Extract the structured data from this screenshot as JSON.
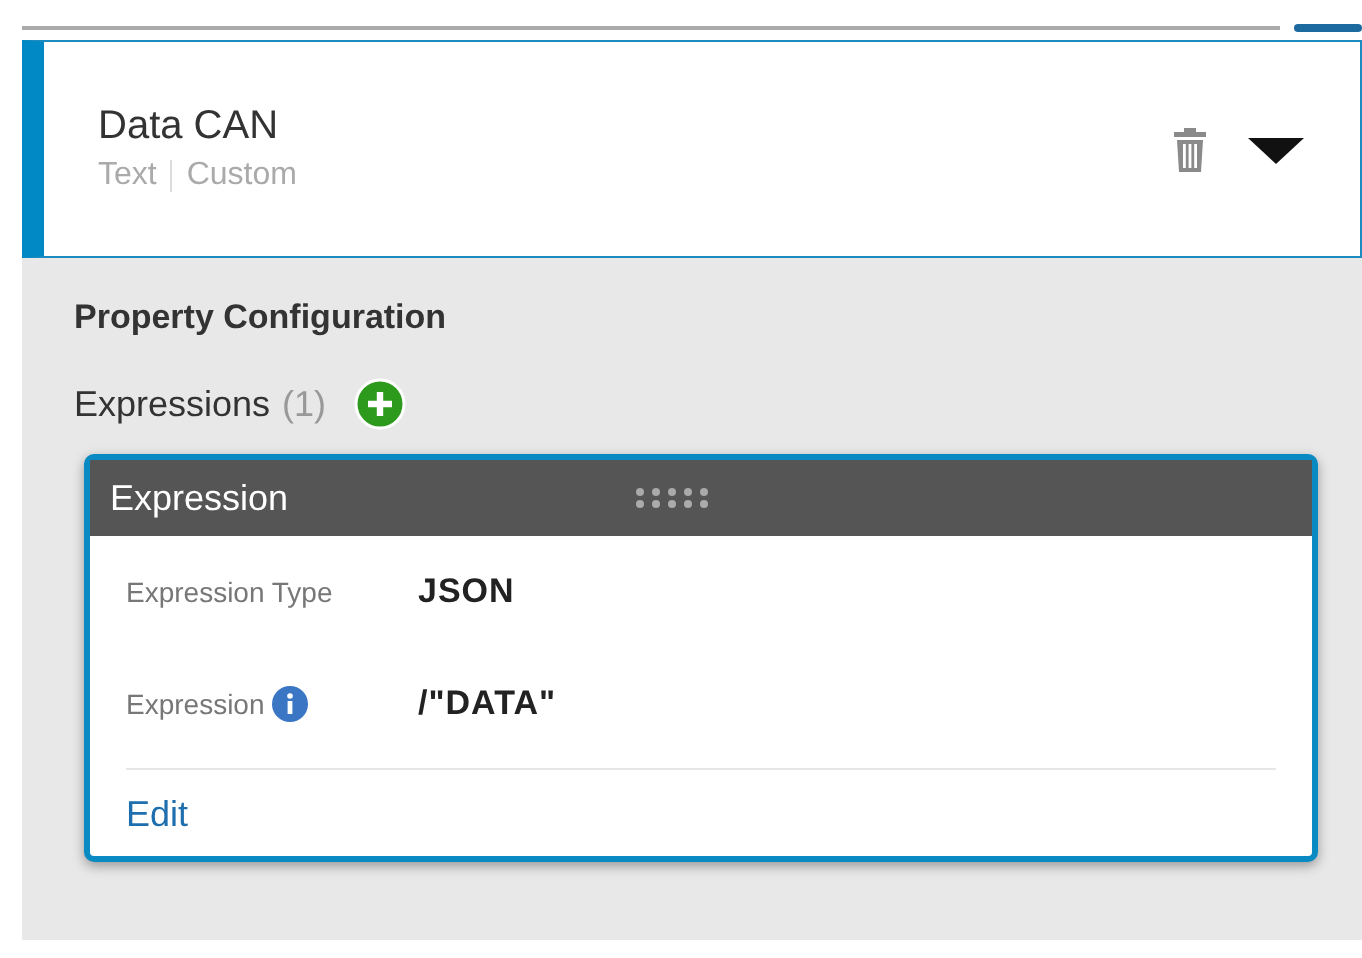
{
  "item": {
    "title": "Data CAN",
    "type": "Text",
    "source": "Custom",
    "expanded": true
  },
  "section_title": "Property Configuration",
  "expressions": {
    "label": "Expressions",
    "count": "(1)",
    "cards": [
      {
        "title": "Expression",
        "rows": [
          {
            "label": "Expression Type",
            "value": "JSON",
            "info": false
          },
          {
            "label": "Expression",
            "value": "/\"DATA\"",
            "info": true
          }
        ],
        "action": "Edit"
      }
    ]
  }
}
